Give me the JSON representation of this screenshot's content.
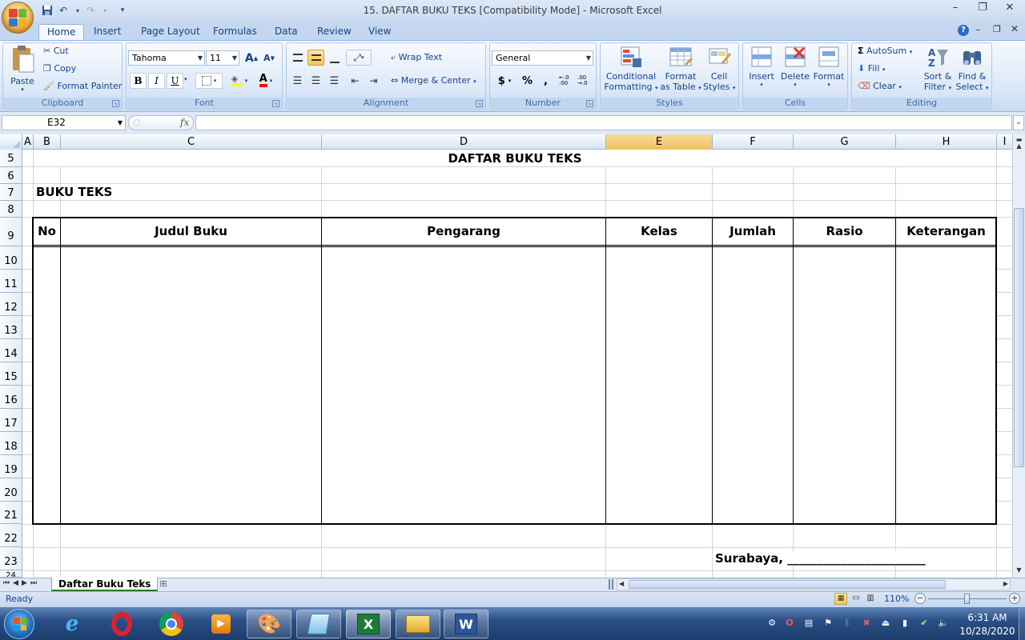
{
  "window": {
    "title": "15. DAFTAR BUKU TEKS  [Compatibility Mode] - Microsoft Excel",
    "minimize": "–",
    "restore": "❐",
    "close": "✕"
  },
  "tabs": [
    "Home",
    "Insert",
    "Page Layout",
    "Formulas",
    "Data",
    "Review",
    "View"
  ],
  "ribbon": {
    "clipboard": {
      "paste": "Paste",
      "cut": "Cut",
      "copy": "Copy",
      "format_painter": "Format Painter",
      "label": "Clipboard"
    },
    "font": {
      "name": "Tahoma",
      "size": "11",
      "label": "Font",
      "bold": "B",
      "italic": "I",
      "underline": "U",
      "grow": "A",
      "shrink": "A"
    },
    "alignment": {
      "wrap_text": "Wrap Text",
      "merge_center": "Merge & Center",
      "label": "Alignment"
    },
    "number": {
      "format": "General",
      "currency": "$",
      "percent": "%",
      "comma": ",",
      "inc_decimal": "←.0 .00",
      "dec_decimal": ".00 →.0",
      "label": "Number"
    },
    "styles": {
      "conditional_1": "Conditional",
      "conditional_2": "Formatting",
      "format_table_1": "Format",
      "format_table_2": "as Table",
      "cell_styles_1": "Cell",
      "cell_styles_2": "Styles",
      "label": "Styles"
    },
    "cells": {
      "insert": "Insert",
      "delete": "Delete",
      "format": "Format",
      "label": "Cells"
    },
    "editing": {
      "autosum": "AutoSum",
      "fill": "Fill",
      "clear": "Clear",
      "sort_1": "Sort &",
      "sort_2": "Filter",
      "find_1": "Find &",
      "find_2": "Select",
      "label": "Editing"
    }
  },
  "formula_bar": {
    "name_box": "E32",
    "fx": "fx",
    "value": ""
  },
  "columns": [
    "A",
    "B",
    "C",
    "D",
    "E",
    "F",
    "G",
    "H",
    "I"
  ],
  "rows": [
    "5",
    "6",
    "7",
    "8",
    "9",
    "10",
    "11",
    "12",
    "13",
    "14",
    "15",
    "16",
    "17",
    "18",
    "19",
    "20",
    "21",
    "22",
    "23",
    "24"
  ],
  "sheet": {
    "title": "DAFTAR BUKU TEKS",
    "subtitle": "BUKU TEKS",
    "headers": [
      "No",
      "Judul Buku",
      "Pengarang",
      "Kelas",
      "Jumlah",
      "Rasio",
      "Keterangan"
    ],
    "signature": "Surabaya, _______________________"
  },
  "sheet_tabs": {
    "active": "Daftar Buku Teks"
  },
  "status": {
    "text": "Ready",
    "zoom": "110%"
  },
  "clock": {
    "time": "6:31 AM",
    "date": "10/28/2020"
  }
}
